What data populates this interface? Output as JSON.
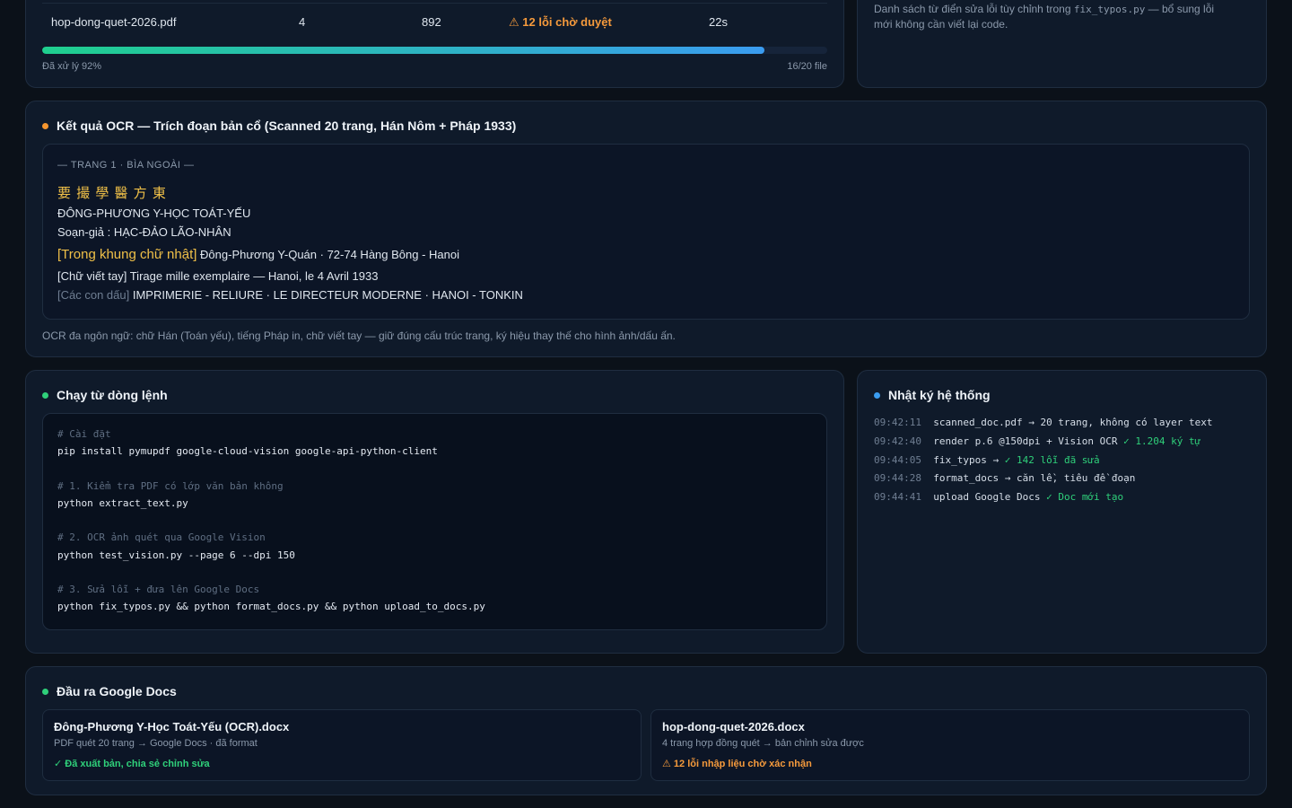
{
  "files": {
    "row": {
      "name": "hop-dong-quet-2026.pdf",
      "pages": "4",
      "words": "892",
      "status_icon": "warning-icon",
      "status": "⚠ 12 lỗi chờ duyệt",
      "time": "22s"
    },
    "progress_fraction": 0.92,
    "progress_label": "Đã xử lý 92%",
    "progress_count": "16/20 file"
  },
  "dict": {
    "note_before": "Danh sách từ điển sửa lỗi tùy chỉnh trong ",
    "note_code": "fix_typos.py",
    "note_after": " — bổ sung lỗi mới không cần viết lại code."
  },
  "ocr": {
    "title": "Kết quả OCR — Trích đoạn bản cổ (Scanned 20 trang, Hán Nôm + Pháp 1933)",
    "dot_color": "#f5962f",
    "page_header": "— TRANG 1 · BÌA NGOÀI —",
    "han_title": "要 撮 學 醫 方 東",
    "line1": "ĐÔNG-PHƯƠNG Y-HỌC TOÁT-YẾU",
    "line2": "Soạn-giả : HẠC-ĐẢO LÃO-NHÂN",
    "line3_tag": "[Trong khung chữ nhật]",
    "line3_text": " Đông-Phương Y-Quán · 72-74 Hàng Bông - Hanoi",
    "line4": "[Chữ viết tay] Tirage mille exemplaire — Hanoi, le 4 Avril 1933",
    "line5_tag": "[Các con dấu]",
    "line5_text": " IMPRIMERIE - RELIURE · LE DIRECTEUR MODERNE · HANOI - TONKIN",
    "note": "OCR đa ngôn ngữ: chữ Hán (Toán yếu), tiếng Pháp in, chữ viết tay — giữ đúng cấu trúc trang, ký hiệu thay thế cho hình ảnh/dấu ấn."
  },
  "cli": {
    "title": "Chạy từ dòng lệnh",
    "dot_color": "#2fd07a",
    "lines": [
      {
        "kind": "comment",
        "text": "# Cài đặt"
      },
      {
        "kind": "cmd",
        "text": "pip install pymupdf google-cloud-vision google-api-python-client"
      },
      {
        "kind": "comment",
        "text": "# 1. Kiểm tra PDF có lớp văn bản không"
      },
      {
        "kind": "cmd",
        "text": "python extract_text.py"
      },
      {
        "kind": "comment",
        "text": "# 2. OCR ảnh quét qua Google Vision"
      },
      {
        "kind": "cmd",
        "text": "python test_vision.py --page 6 --dpi 150"
      },
      {
        "kind": "comment",
        "text": "# 3. Sửa lỗi + đưa lên Google Docs"
      },
      {
        "kind": "cmd",
        "text": "python fix_typos.py && python format_docs.py && python upload_to_docs.py"
      }
    ]
  },
  "log": {
    "title": "Nhật ký hệ thống",
    "dot_color": "#3a9cf0",
    "entries": [
      {
        "time": "09:42:11",
        "msg": "scanned_doc.pdf → 20 trang, không có layer text",
        "ok": ""
      },
      {
        "time": "09:42:40",
        "msg": "render p.6 @150dpi + Vision OCR ",
        "ok": "✓ 1.204 ký tự"
      },
      {
        "time": "09:44:05",
        "msg": "fix_typos → ",
        "ok": "✓ 142 lỗi đã sửa"
      },
      {
        "time": "09:44:28",
        "msg": "format_docs → căn lề, tiêu đề đoạn",
        "ok": ""
      },
      {
        "time": "09:44:41",
        "msg": "upload Google Docs ",
        "ok": "✓ Doc mới tạo"
      }
    ]
  },
  "docs": {
    "title": "Đầu ra Google Docs",
    "dot_color": "#2fd07a",
    "cards": [
      {
        "name": "Đông-Phương Y-Học Toát-Yếu (OCR).docx",
        "desc": "PDF quét 20 trang → Google Docs · đã format",
        "status": "✓ Đã xuất bản, chia sẻ chỉnh sửa",
        "status_kind": "ok"
      },
      {
        "name": "hop-dong-quet-2026.docx",
        "desc": "4 trang hợp đồng quét → bản chỉnh sửa được",
        "status": "⚠ 12 lỗi nhập liệu chờ xác nhận",
        "status_kind": "warn"
      }
    ]
  }
}
